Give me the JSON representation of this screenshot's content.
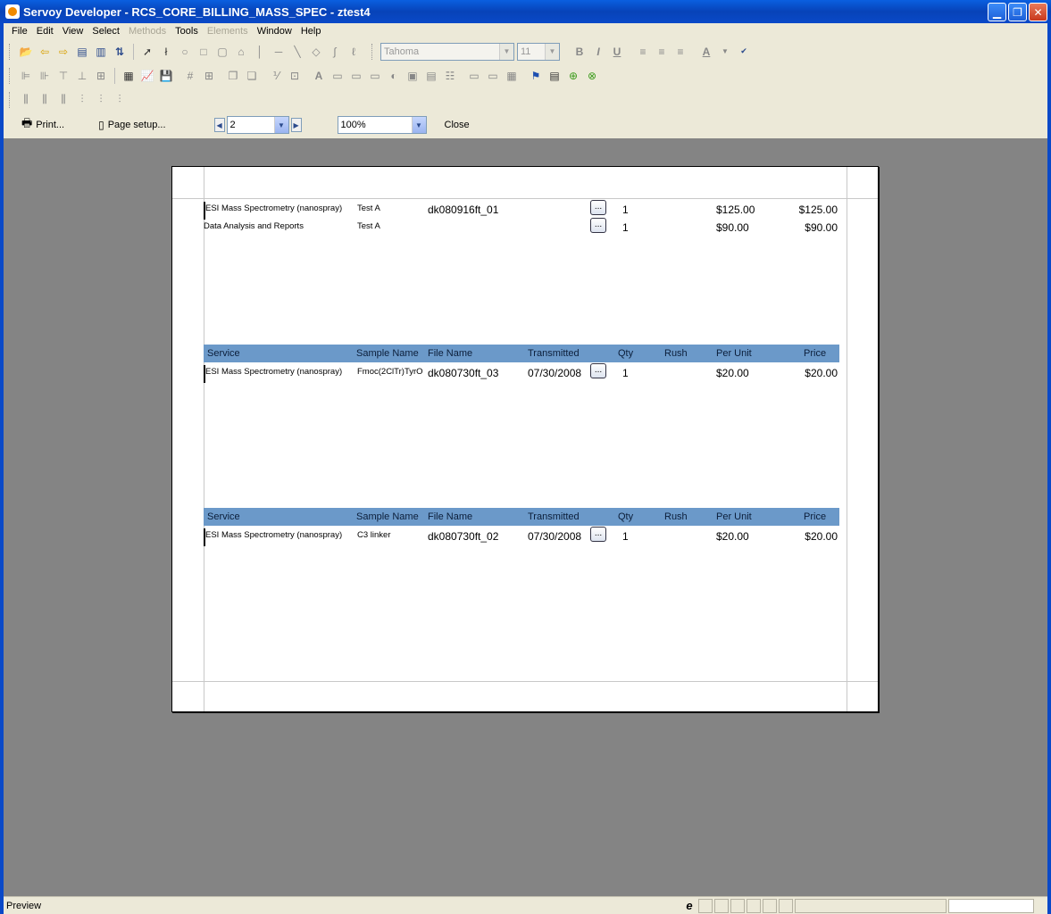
{
  "window": {
    "title": "Servoy Developer - RCS_CORE_BILLING_MASS_SPEC - ztest4"
  },
  "menu": [
    "File",
    "Edit",
    "View",
    "Select",
    "Methods",
    "Tools",
    "Elements",
    "Window",
    "Help"
  ],
  "menu_disabled": [
    "Methods",
    "Elements"
  ],
  "format_toolbar": {
    "font_family": "Tahoma",
    "font_size": "11",
    "bold_label": "B",
    "italic_label": "I",
    "underline_label": "U"
  },
  "preview_toolbar": {
    "print_label": "Print...",
    "page_setup_label": "Page setup...",
    "page_number": "2",
    "zoom": "100%",
    "close_label": "Close"
  },
  "report": {
    "columns": [
      "Service",
      "Sample Name",
      "File Name",
      "Transmitted",
      "Qty",
      "Rush",
      "Per Unit",
      "Price"
    ],
    "dots_label": "...",
    "group1_rows": [
      {
        "service": "ESI Mass Spectrometry (nanospray)",
        "sample": "Test A",
        "file": "dk080916ft_01",
        "transmitted": "",
        "qty": "1",
        "per_unit": "$125.00",
        "price": "$125.00"
      },
      {
        "service": "Data Analysis and Reports",
        "sample": "Test A",
        "file": "",
        "transmitted": "",
        "qty": "1",
        "per_unit": "$90.00",
        "price": "$90.00"
      }
    ],
    "group2_rows": [
      {
        "service": "ESI Mass Spectrometry (nanospray)",
        "sample": "Fmoc(2ClTr)TyrO",
        "file": "dk080730ft_03",
        "transmitted": "07/30/2008",
        "qty": "1",
        "per_unit": "$20.00",
        "price": "$20.00"
      }
    ],
    "group3_rows": [
      {
        "service": "ESI Mass Spectrometry (nanospray)",
        "sample": "C3 linker",
        "file": "dk080730ft_02",
        "transmitted": "07/30/2008",
        "qty": "1",
        "per_unit": "$20.00",
        "price": "$20.00"
      }
    ]
  },
  "status": {
    "text": "Preview",
    "indicator": "e"
  }
}
